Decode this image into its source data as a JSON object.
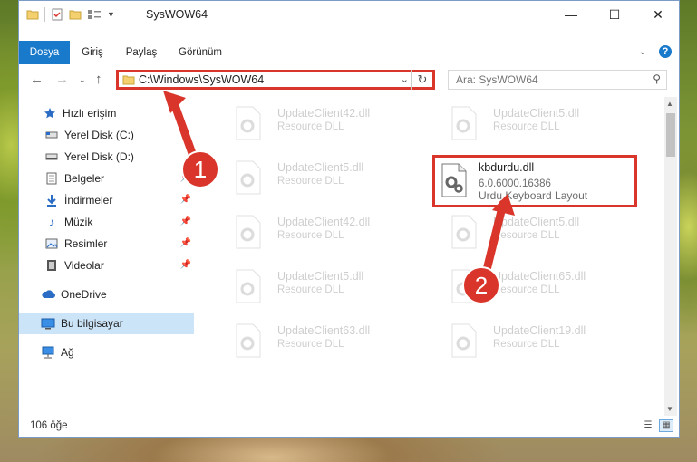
{
  "titlebar": {
    "title": "SysWOW64",
    "minimize": "—",
    "maximize": "☐",
    "close": "✕"
  },
  "ribbon": {
    "tabs": [
      {
        "label": "Dosya",
        "active": true
      },
      {
        "label": "Giriş",
        "active": false
      },
      {
        "label": "Paylaş",
        "active": false
      },
      {
        "label": "Görünüm",
        "active": false
      }
    ],
    "accent": "#1979ca"
  },
  "address": {
    "path": "C:\\Windows\\SysWOW64",
    "search_placeholder": "Ara: SysWOW64"
  },
  "sidebar": {
    "items": [
      {
        "label": "Hızlı erişim",
        "icon": "star-icon"
      },
      {
        "label": "Yerel Disk (C:)",
        "icon": "drive-icon"
      },
      {
        "label": "Yerel Disk (D:)",
        "icon": "drive-icon"
      },
      {
        "label": "Belgeler",
        "icon": "documents-icon"
      },
      {
        "label": "İndirmeler",
        "icon": "download-icon"
      },
      {
        "label": "Müzik",
        "icon": "music-icon"
      },
      {
        "label": "Resimler",
        "icon": "pictures-icon"
      },
      {
        "label": "Videolar",
        "icon": "video-icon"
      },
      {
        "label": "OneDrive",
        "icon": "cloud-icon"
      },
      {
        "label": "Bu bilgisayar",
        "icon": "computer-icon",
        "selected": true
      },
      {
        "label": "Ağ",
        "icon": "network-icon"
      }
    ]
  },
  "files": {
    "faded": [
      {
        "name": "UpdateClient42.dll",
        "desc": "Resource DLL"
      },
      {
        "name": "UpdateClient5.dll",
        "desc": "Resource DLL"
      },
      {
        "name": "UpdateClient5.dll",
        "desc": "Resource DLL"
      },
      {
        "name": "UpdateClient42.dll",
        "desc": "Resource DLL"
      },
      {
        "name": "UpdateClient5.dll",
        "desc": "Resource DLL"
      },
      {
        "name": "UpdateClient5.dll",
        "desc": "Resource DLL"
      },
      {
        "name": "UpdateClient65.dll",
        "desc": "Resource DLL"
      },
      {
        "name": "UpdateClient63.dll",
        "desc": "Resource DLL"
      },
      {
        "name": "UpdateClient19.dll",
        "desc": "Resource DLL"
      }
    ],
    "highlighted": {
      "name": "kbdurdu.dll",
      "version": "6.0.6000.16386",
      "desc": "Urdu Keyboard Layout"
    }
  },
  "status": {
    "count": "106 öğe"
  },
  "annotations": {
    "step1": "1",
    "step2": "2",
    "color": "#d9352a"
  }
}
